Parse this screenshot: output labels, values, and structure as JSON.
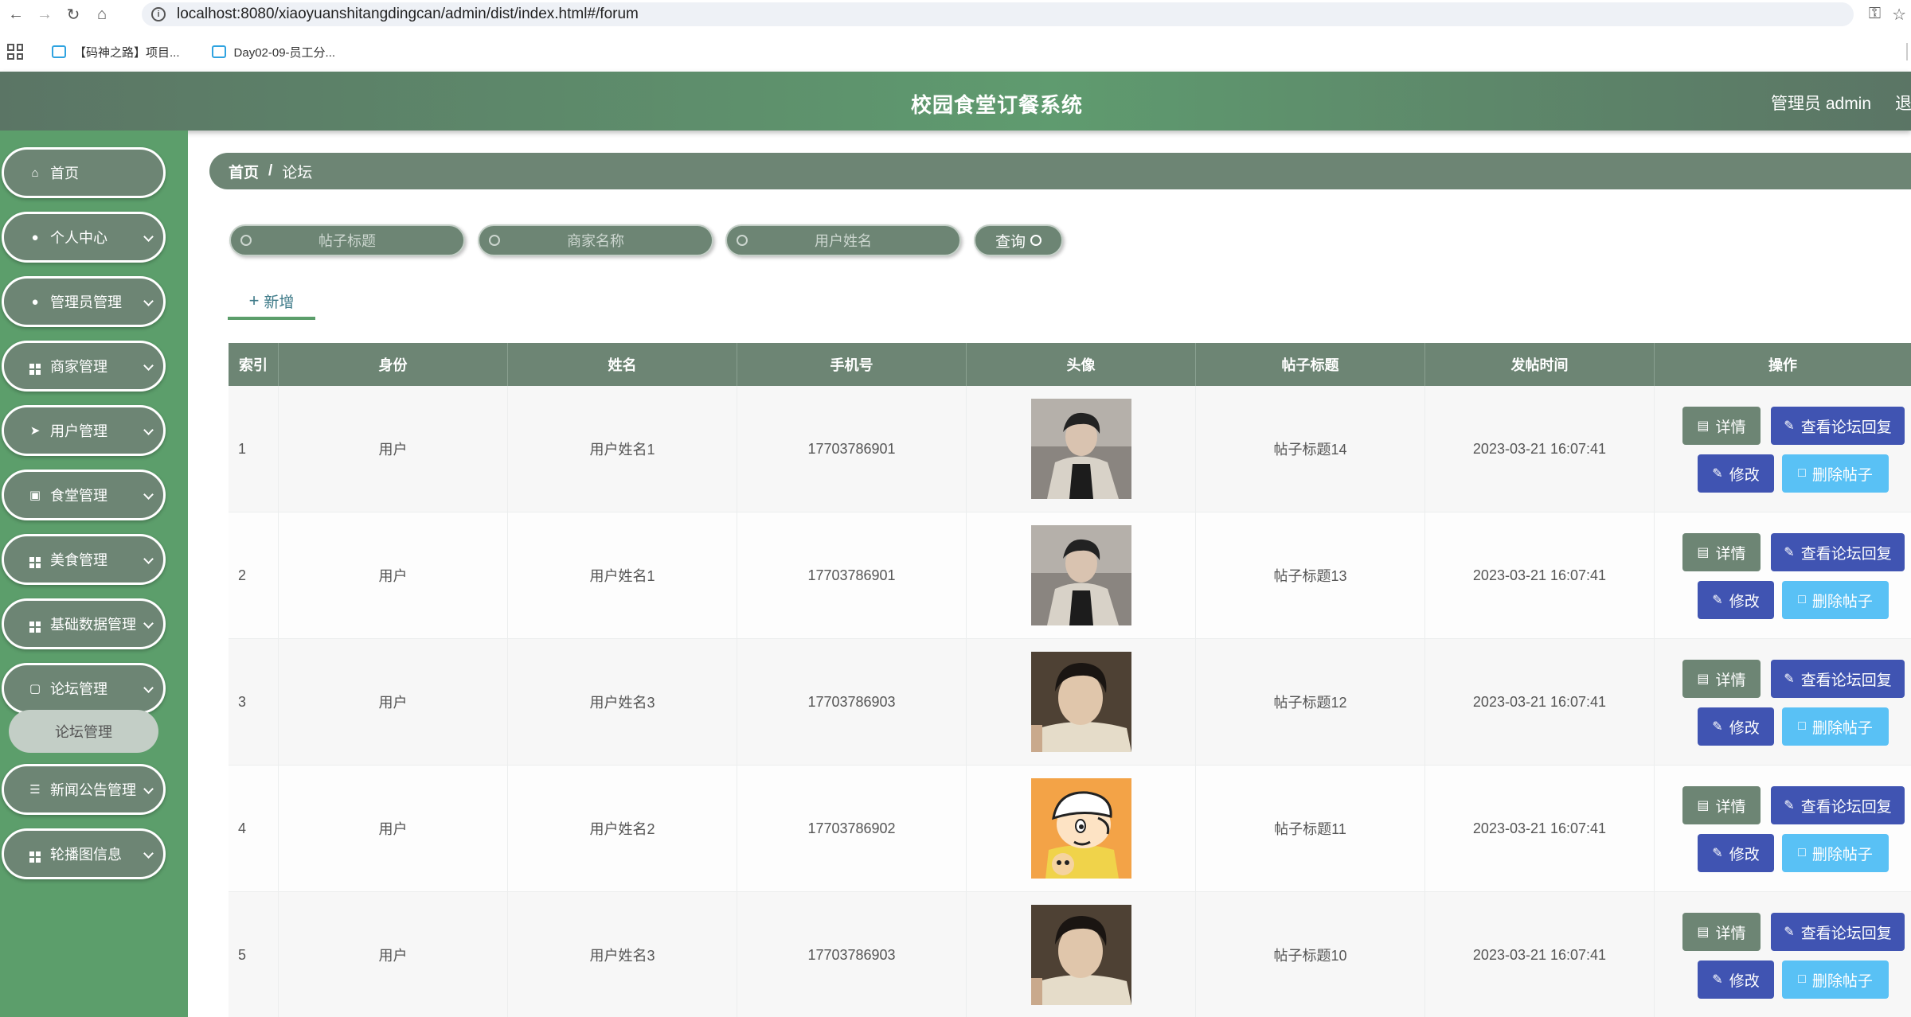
{
  "browser": {
    "url": "localhost:8080/xiaoyuanshitangdingcan/admin/dist/index.html#/forum",
    "bookmarks": [
      "【码神之路】项目...",
      "Day02-09-员工分..."
    ]
  },
  "header": {
    "title": "校园食堂订餐系统",
    "admin": "管理员 admin",
    "logout": "退"
  },
  "sidebar": {
    "items": [
      {
        "label": "首页",
        "icon": "home-icon"
      },
      {
        "label": "个人中心",
        "icon": "user-icon"
      },
      {
        "label": "管理员管理",
        "icon": "bulb-icon"
      },
      {
        "label": "商家管理",
        "icon": "grid-icon"
      },
      {
        "label": "用户管理",
        "icon": "send-icon"
      },
      {
        "label": "食堂管理",
        "icon": "briefcase-icon"
      },
      {
        "label": "美食管理",
        "icon": "grid-icon"
      },
      {
        "label": "基础数据管理",
        "icon": "grid-icon"
      },
      {
        "label": "论坛管理",
        "icon": "trash-icon"
      },
      {
        "label": "新闻公告管理",
        "icon": "sliders-icon"
      },
      {
        "label": "轮播图信息",
        "icon": "grid-icon"
      }
    ],
    "submenu": "论坛管理"
  },
  "breadcrumb": {
    "home": "首页",
    "sep": "/",
    "current": "论坛"
  },
  "search": {
    "title_placeholder": "帖子标题",
    "merchant_placeholder": "商家名称",
    "user_placeholder": "用户姓名",
    "query_label": "查询"
  },
  "add_label": "新增",
  "table": {
    "headers": [
      "索引",
      "身份",
      "姓名",
      "手机号",
      "头像",
      "帖子标题",
      "发帖时间",
      "操作"
    ],
    "rows": [
      {
        "idx": "1",
        "role": "用户",
        "name": "用户姓名1",
        "phone": "17703786901",
        "avatar": "man-coat",
        "title": "帖子标题14",
        "time": "2023-03-21 16:07:41"
      },
      {
        "idx": "2",
        "role": "用户",
        "name": "用户姓名1",
        "phone": "17703786901",
        "avatar": "man-coat",
        "title": "帖子标题13",
        "time": "2023-03-21 16:07:41"
      },
      {
        "idx": "3",
        "role": "用户",
        "name": "用户姓名3",
        "phone": "17703786903",
        "avatar": "man-selfie",
        "title": "帖子标题12",
        "time": "2023-03-21 16:07:41"
      },
      {
        "idx": "4",
        "role": "用户",
        "name": "用户姓名2",
        "phone": "17703786902",
        "avatar": "cartoon",
        "title": "帖子标题11",
        "time": "2023-03-21 16:07:41"
      },
      {
        "idx": "5",
        "role": "用户",
        "name": "用户姓名3",
        "phone": "17703786903",
        "avatar": "man-selfie",
        "title": "帖子标题10",
        "time": "2023-03-21 16:07:41"
      }
    ],
    "actions": {
      "detail": "详情",
      "reply": "查看论坛回复",
      "edit": "修改",
      "delete": "删除帖子"
    }
  }
}
